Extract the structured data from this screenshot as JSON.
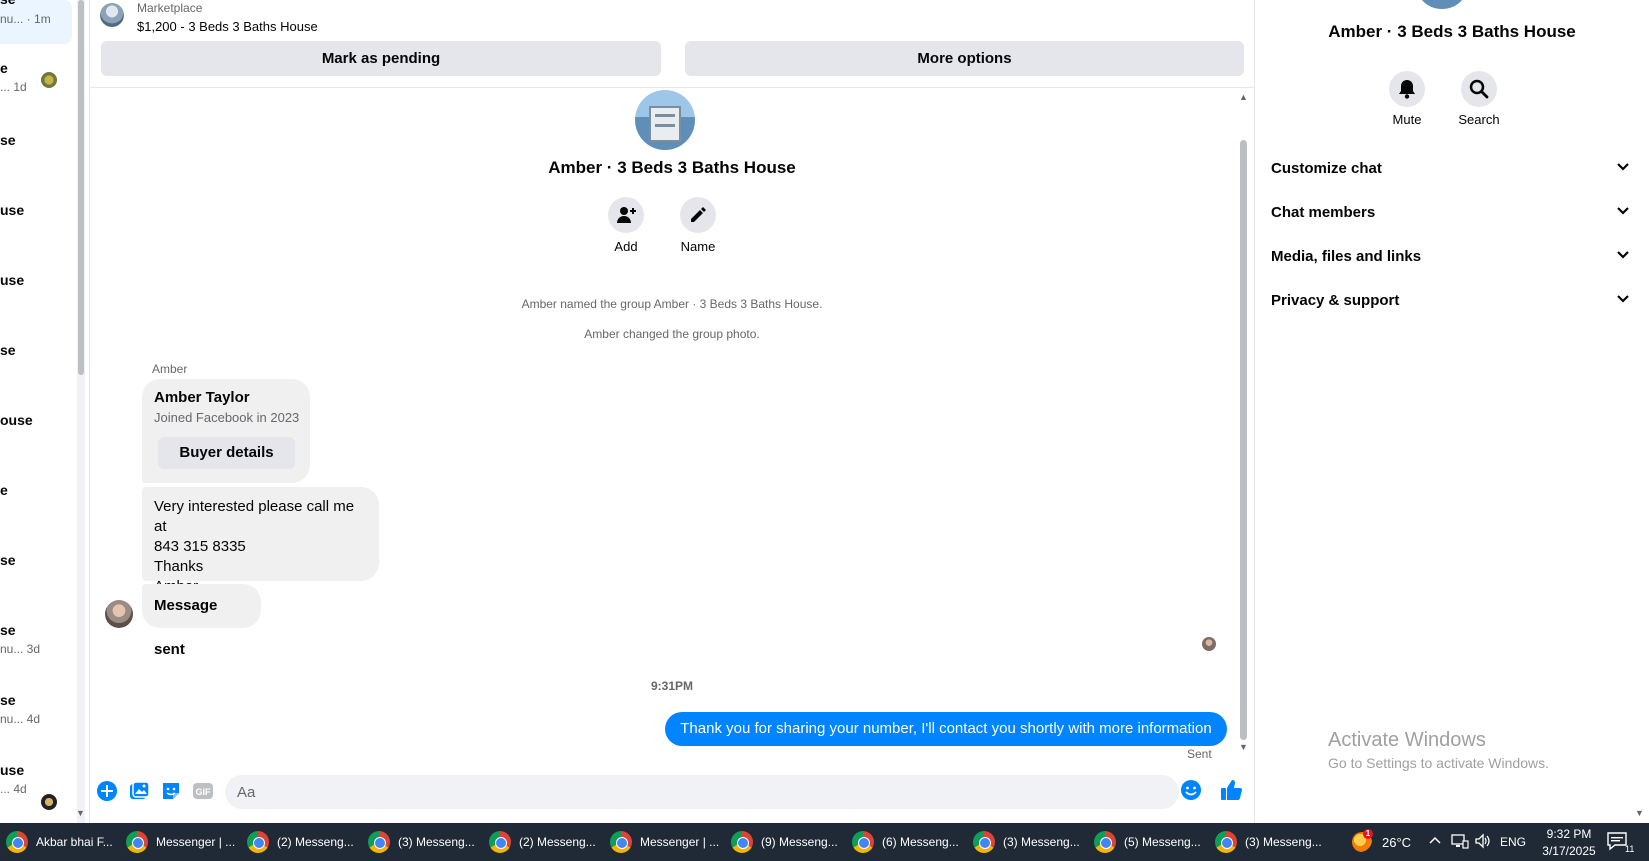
{
  "left_list": {
    "items": [
      {
        "title": "se",
        "sub": "nu... · 1m"
      },
      {
        "title": "e",
        "sub": "... 1d"
      },
      {
        "title": "se",
        "sub": ""
      },
      {
        "title": "use",
        "sub": ""
      },
      {
        "title": "use",
        "sub": ""
      },
      {
        "title": "se",
        "sub": ""
      },
      {
        "title": "ouse",
        "sub": ""
      },
      {
        "title": "e",
        "sub": ""
      },
      {
        "title": "se",
        "sub": ""
      },
      {
        "title": "se",
        "sub": "nu... 3d"
      },
      {
        "title": "se",
        "sub": "nu... 4d"
      },
      {
        "title": "use",
        "sub": "... 4d"
      }
    ]
  },
  "marketplace": {
    "label": "Marketplace",
    "listing": "$1,200 - 3 Beds 3 Baths House",
    "pending_button": "Mark as pending",
    "more_button": "More options"
  },
  "chat": {
    "group_title": "Amber · 3 Beds 3 Baths House",
    "add_label": "Add",
    "name_label": "Name",
    "system_messages": [
      "Amber named the group Amber · 3 Beds 3 Baths House.",
      "Amber changed the group photo."
    ],
    "sender_name": "Amber",
    "card": {
      "name": "Amber Taylor",
      "joined": "Joined Facebook in 2023",
      "button": "Buyer details"
    },
    "incoming_lines": [
      "Very interested please call me at",
      "843 315 8335",
      "Thanks",
      "Amber"
    ],
    "message_sent": "Message sent",
    "time_divider": "9:31PM",
    "outgoing": "Thank you for sharing your number, I'll contact you shortly with more information",
    "sent_status": "Sent"
  },
  "composer": {
    "placeholder": "Aa",
    "gif_label": "GIF"
  },
  "right_panel": {
    "title": "Amber · 3 Beds 3 Baths House",
    "mute_label": "Mute",
    "search_label": "Search",
    "menu": [
      "Customize chat",
      "Chat members",
      "Media, files and links",
      "Privacy & support"
    ],
    "activate_title": "Activate Windows",
    "activate_sub": "Go to Settings to activate Windows."
  },
  "taskbar": {
    "items": [
      "Akbar bhai F...",
      "Messenger | ...",
      "(2) Messeng...",
      "(3) Messeng...",
      "(2) Messeng...",
      "Messenger | ...",
      "(9) Messeng...",
      "(6) Messeng...",
      "(3) Messeng...",
      "(5) Messeng...",
      "(3) Messeng..."
    ],
    "weather_badge": "1",
    "temperature": "26°C",
    "language": "ENG",
    "time": "9:32 PM",
    "date": "3/17/2025",
    "notification_count": "11"
  },
  "colors": {
    "accent": "#0084ff",
    "bubble_gray": "#f0f0f0",
    "button_gray": "#e4e6eb",
    "taskbar": "#202a36"
  }
}
